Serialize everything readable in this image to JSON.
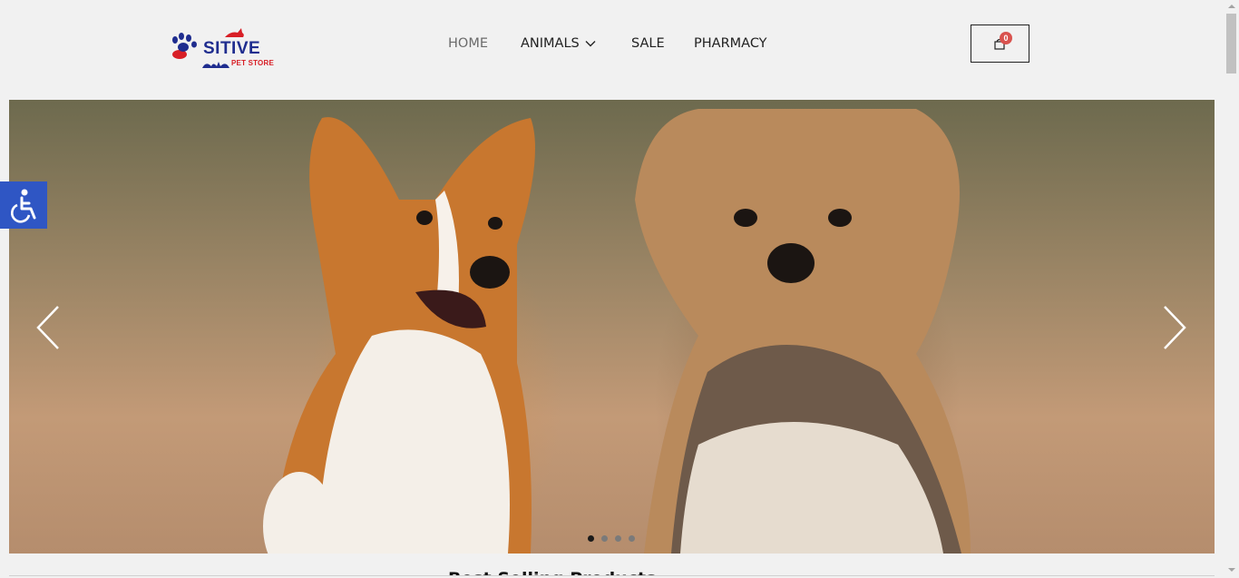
{
  "header": {
    "logo": {
      "word": "SITIVE",
      "subtitle": "PET STORE",
      "icon": "paw-pet-logo-icon"
    },
    "nav": [
      {
        "label": "HOME",
        "active": true
      },
      {
        "label": "ANIMALS",
        "has_dropdown": true,
        "dropdown_icon": "chevron-down-icon"
      },
      {
        "label": "SALE"
      },
      {
        "label": "PHARMACY"
      }
    ],
    "cart": {
      "count": "0",
      "icon": "shopping-bag-icon"
    }
  },
  "slider": {
    "image": "corgi-and-yorkshire-terrier-photo",
    "prev_icon": "chevron-left-icon",
    "next_icon": "chevron-right-icon",
    "active_slide": 1,
    "slide_count": 4
  },
  "accessibility": {
    "icon": "wheelchair-accessibility-icon"
  },
  "section": {
    "title": "Best Selling Products"
  },
  "colors": {
    "accent_blue": "#2f56c4",
    "logo_blue": "#1f2d8f",
    "logo_red": "#d81f26",
    "badge_red": "#d9534f"
  }
}
